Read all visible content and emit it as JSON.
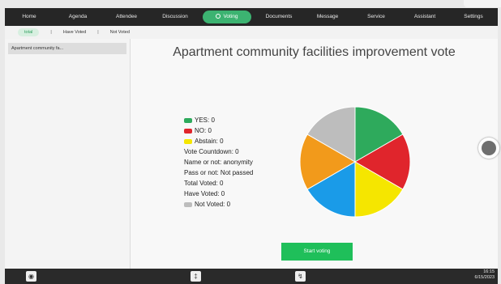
{
  "nav": {
    "items": [
      "Home",
      "Agenda",
      "Attendee",
      "Discussion",
      "Voting",
      "Documents",
      "Message",
      "Service",
      "Assistant",
      "Settings"
    ],
    "active_index": 4
  },
  "subnav": {
    "total": "total",
    "sep1": "|",
    "have_voted": "Have Voted",
    "sep2": "|",
    "not_voted": "Not Voted"
  },
  "sidebar": {
    "items": [
      {
        "label": "Apartment community fa..."
      }
    ]
  },
  "vote": {
    "title": "Apartment community facilities improvement vote",
    "stats": {
      "yes": "YES: 0",
      "no": "NO: 0",
      "abstain": "Abstain: 0",
      "countdown": "Vote Countdown: 0",
      "name": "Name or not: anonymity",
      "pass": "Pass or not: Not passed",
      "total_voted": "Total Voted: 0",
      "have_voted": "Have Voted: 0",
      "not_voted": "Not Voted: 0"
    },
    "start_button": "Start voting"
  },
  "colors": {
    "yes": "#2eaa5c",
    "no": "#e0252c",
    "abstain": "#f5e600",
    "not_voted": "#bdbdbd",
    "blue": "#1a9be8",
    "orange": "#f29a1b",
    "accent": "#1fbf5a"
  },
  "chart_data": {
    "type": "pie",
    "values": [
      1,
      1,
      1,
      1,
      1,
      1
    ],
    "colors": [
      "#2eaa5c",
      "#e0252c",
      "#f5e600",
      "#1a9be8",
      "#f29a1b",
      "#bdbdbd"
    ]
  },
  "clock": {
    "time": "16:15",
    "date": "6/15/2023"
  },
  "bottom_icons": [
    "headset-icon",
    "microphone-icon",
    "screen-share-icon"
  ]
}
